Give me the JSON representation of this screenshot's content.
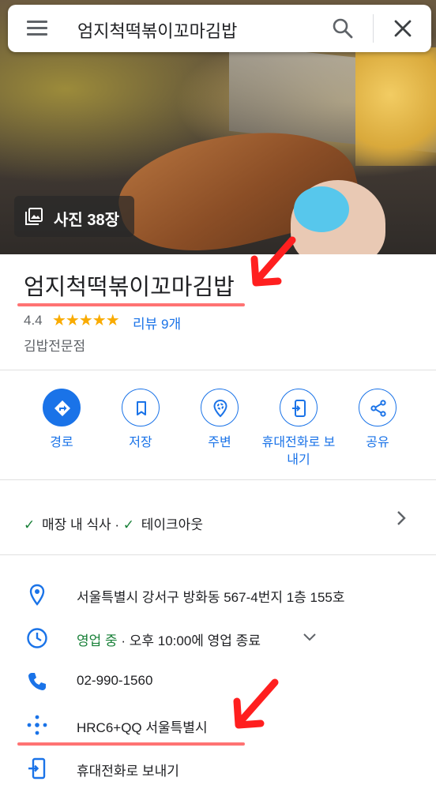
{
  "search": {
    "query": "엄지척떡볶이꼬마김밥"
  },
  "photos": {
    "label": "사진 38장"
  },
  "place": {
    "name": "엄지척떡볶이꼬마김밥",
    "rating": "4.4",
    "stars": "★★★★★",
    "reviews": "리뷰 9개",
    "category": "김밥전문점"
  },
  "actions": [
    {
      "label": "경로",
      "icon": "directions-icon"
    },
    {
      "label": "저장",
      "icon": "bookmark-icon"
    },
    {
      "label": "주변",
      "icon": "nearby-icon"
    },
    {
      "label": "휴대전화로 보내기",
      "label_line1": "휴대전화로 보",
      "label_line2": "내기",
      "icon": "send-to-phone-icon"
    },
    {
      "label": "공유",
      "icon": "share-icon"
    }
  ],
  "services": {
    "dine_in": "매장 내 식사",
    "separator": "·",
    "takeout": "테이크아웃"
  },
  "info": {
    "address": "서울특별시 강서구 방화동 567-4번지 1층 155호",
    "hours_status": "영업 중",
    "hours_detail": " · 오후 10:00에 영업 종료",
    "phone": "02-990-1560",
    "plus_code": "HRC6+QQ 서울특별시",
    "send_to_phone": "휴대전화로 보내기"
  },
  "colors": {
    "accent": "#1a73e8",
    "open_green": "#188038",
    "star": "#f9ab00",
    "annotation_red": "#ff2a2a"
  }
}
